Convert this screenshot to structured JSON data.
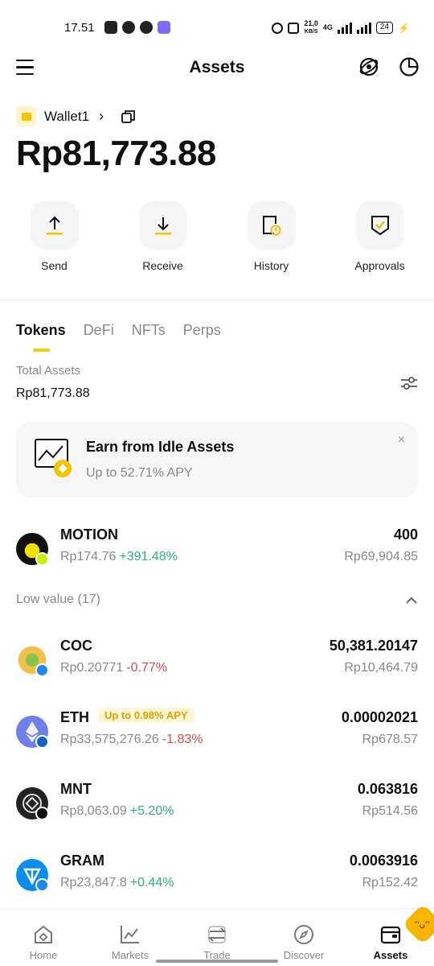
{
  "status_bar": {
    "time": "17.51",
    "net_speed": "21,0",
    "net_unit": "KB/S",
    "network": "4G",
    "battery": "24"
  },
  "header": {
    "title": "Assets"
  },
  "wallet": {
    "name": "Wallet1",
    "balance": "Rp81,773.88"
  },
  "actions": [
    {
      "label": "Send",
      "icon": "send-icon"
    },
    {
      "label": "Receive",
      "icon": "receive-icon"
    },
    {
      "label": "History",
      "icon": "history-icon"
    },
    {
      "label": "Approvals",
      "icon": "approvals-icon"
    }
  ],
  "tabs": [
    {
      "label": "Tokens",
      "active": true
    },
    {
      "label": "DeFi",
      "active": false
    },
    {
      "label": "NFTs",
      "active": false
    },
    {
      "label": "Perps",
      "active": false
    }
  ],
  "summary": {
    "label": "Total Assets",
    "value": "Rp81,773.88"
  },
  "earn_card": {
    "title": "Earn from Idle Assets",
    "subtitle": "Up to 52.71% APY",
    "close": "×"
  },
  "tokens": [
    {
      "name": "MOTION",
      "price": "Rp174.76",
      "change": "+391.48%",
      "amount": "400",
      "value": "Rp69,904.85"
    }
  ],
  "low_value": {
    "label": "Low value (17)",
    "tokens": [
      {
        "name": "COC",
        "price": "Rp0.20771",
        "change": "-0.77%",
        "amount": "50,381.20147",
        "value": "Rp10,464.79"
      },
      {
        "name": "ETH",
        "badge": "Up to 0.98% APY",
        "price": "Rp33,575,276.26",
        "change": "-1.83%",
        "amount": "0.00002021",
        "value": "Rp678.57"
      },
      {
        "name": "MNT",
        "price": "Rp8,063.09",
        "change": "+5.20%",
        "amount": "0.063816",
        "value": "Rp514.56"
      },
      {
        "name": "GRAM",
        "price": "Rp23,847.8",
        "change": "+0.44%",
        "amount": "0.0063916",
        "value": "Rp152.42"
      }
    ]
  },
  "bottom_nav": [
    {
      "label": "Home",
      "icon": "home-icon"
    },
    {
      "label": "Markets",
      "icon": "markets-icon"
    },
    {
      "label": "Trade",
      "icon": "trade-icon"
    },
    {
      "label": "Discover",
      "icon": "discover-icon"
    },
    {
      "label": "Assets",
      "icon": "assets-icon",
      "active": true
    }
  ],
  "colors": {
    "accent": "#f5d000",
    "positive": "#2bb673",
    "negative": "#e5484d"
  }
}
